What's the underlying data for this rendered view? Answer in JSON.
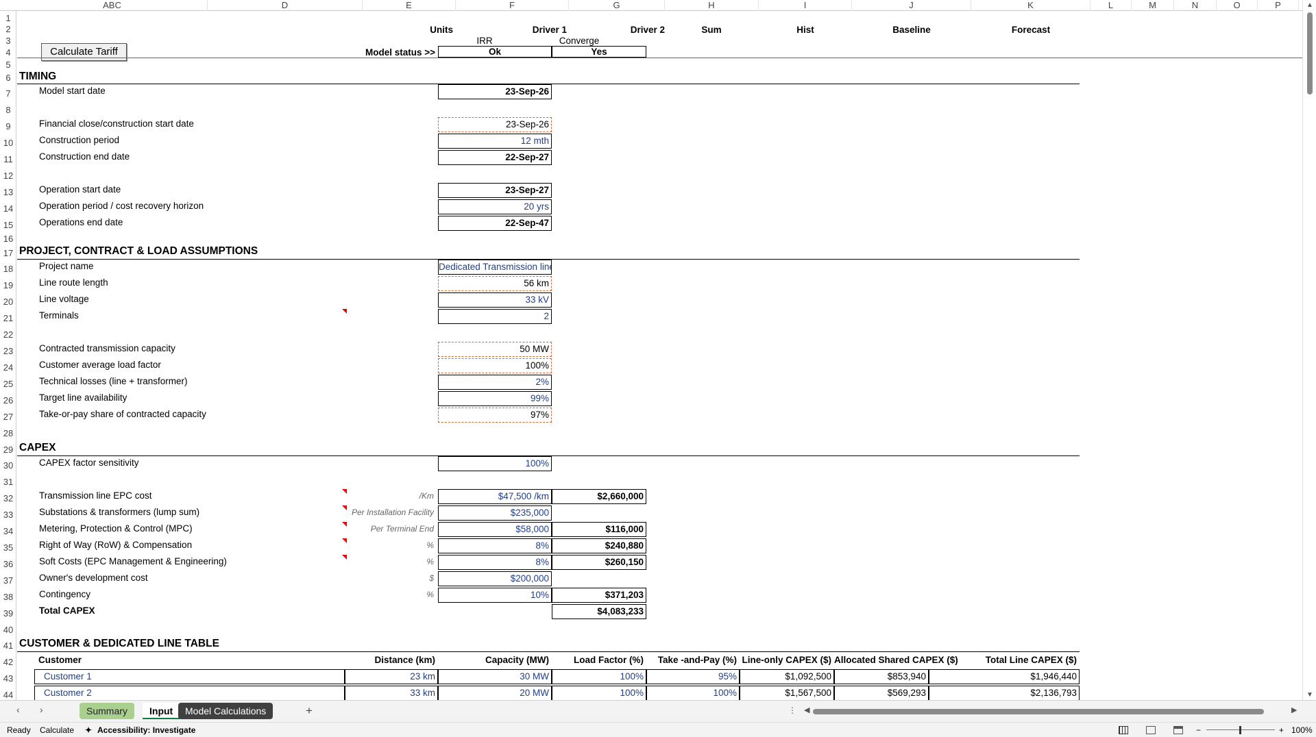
{
  "columns": [
    "ABC",
    "D",
    "E",
    "F",
    "G",
    "H",
    "I",
    "J",
    "K",
    "L",
    "M",
    "N",
    "O",
    "P"
  ],
  "button_label": "Calculate Tariff",
  "header": {
    "units": "Units",
    "driver1": "Driver 1",
    "driver2": "Driver 2",
    "sum": "Sum",
    "hist": "Hist",
    "baseline": "Baseline",
    "forecast": "Forecast",
    "irr": "IRR",
    "converge": "Converge",
    "model_status_label": "Model status >>",
    "status_ok": "Ok",
    "status_yes": "Yes"
  },
  "sections": {
    "timing": "TIMING",
    "project": "PROJECT, CONTRACT & LOAD ASSUMPTIONS",
    "capex": "CAPEX",
    "customer": "CUSTOMER & DEDICATED LINE TABLE"
  },
  "timing": {
    "model_start_label": "Model start date",
    "model_start_value": "23-Sep-26",
    "fin_close_label": "Financial close/construction start date",
    "fin_close_value": "23-Sep-26",
    "constr_period_label": "Construction period",
    "constr_period_value": "12 mth",
    "constr_end_label": "Construction end date",
    "constr_end_value": "22-Sep-27",
    "op_start_label": "Operation start date",
    "op_start_value": "23-Sep-27",
    "op_period_label": "Operation period / cost recovery horizon",
    "op_period_value": "20 yrs",
    "op_end_label": "Operations end date",
    "op_end_value": "22-Sep-47"
  },
  "project": {
    "name_label": "Project name",
    "name_value": "Dedicated Transmission line",
    "route_label": "Line route length",
    "route_value": "56 km",
    "voltage_label": "Line voltage",
    "voltage_value": "33 kV",
    "terminals_label": "Terminals",
    "terminals_value": "2",
    "capacity_label": "Contracted transmission capacity",
    "capacity_value": "50 MW",
    "loadfactor_label": "Customer average load factor",
    "loadfactor_value": "100%",
    "losses_label": "Technical losses (line + transformer)",
    "losses_value": "2%",
    "availability_label": "Target line availability",
    "availability_value": "99%",
    "takeorpay_label": "Take-or-pay share of contracted capacity",
    "takeorpay_value": "97%"
  },
  "capex": {
    "sens_label": "CAPEX factor sensitivity",
    "sens_value": "100%",
    "rows": [
      {
        "label": "Transmission line EPC cost",
        "unit": "/Km",
        "input": "$47,500 /km",
        "calc": "$2,660,000"
      },
      {
        "label": "Substations & transformers (lump sum)",
        "unit": "Per Installation Facility",
        "input": "$235,000",
        "calc": ""
      },
      {
        "label": "Metering, Protection & Control (MPC)",
        "unit": "Per Terminal End",
        "input": "$58,000",
        "calc": "$116,000"
      },
      {
        "label": "Right of Way (RoW) & Compensation",
        "unit": "%",
        "input": "8%",
        "calc": "$240,880"
      },
      {
        "label": "Soft Costs (EPC Management & Engineering)",
        "unit": "%",
        "input": "8%",
        "calc": "$260,150"
      },
      {
        "label": "Owner's development cost",
        "unit": "$",
        "input": "$200,000",
        "calc": ""
      },
      {
        "label": "Contingency",
        "unit": "%",
        "input": "10%",
        "calc": "$371,203"
      }
    ],
    "total_label": "Total CAPEX",
    "total_value": "$4,083,233"
  },
  "customer_table": {
    "headers": [
      "Customer",
      "Distance (km)",
      "Capacity (MW)",
      "Load Factor (%)",
      "Take -and-Pay (%)",
      "Line-only CAPEX ($)",
      "Allocated Shared CAPEX ($)",
      "Total Line CAPEX ($)"
    ],
    "rows": [
      [
        "Customer 1",
        "23 km",
        "30 MW",
        "100%",
        "95%",
        "$1,092,500",
        "$853,940",
        "$1,946,440"
      ],
      [
        "Customer 2",
        "33 km",
        "20 MW",
        "100%",
        "100%",
        "$1,567,500",
        "$569,293",
        "$2,136,793"
      ]
    ]
  },
  "tabs": {
    "summary": "Summary",
    "input": "Input",
    "model_calc": "Model Calculations",
    "add": "+"
  },
  "status": {
    "ready": "Ready",
    "calculate": "Calculate",
    "accessibility": "Accessibility: Investigate",
    "zoom": "100%"
  }
}
